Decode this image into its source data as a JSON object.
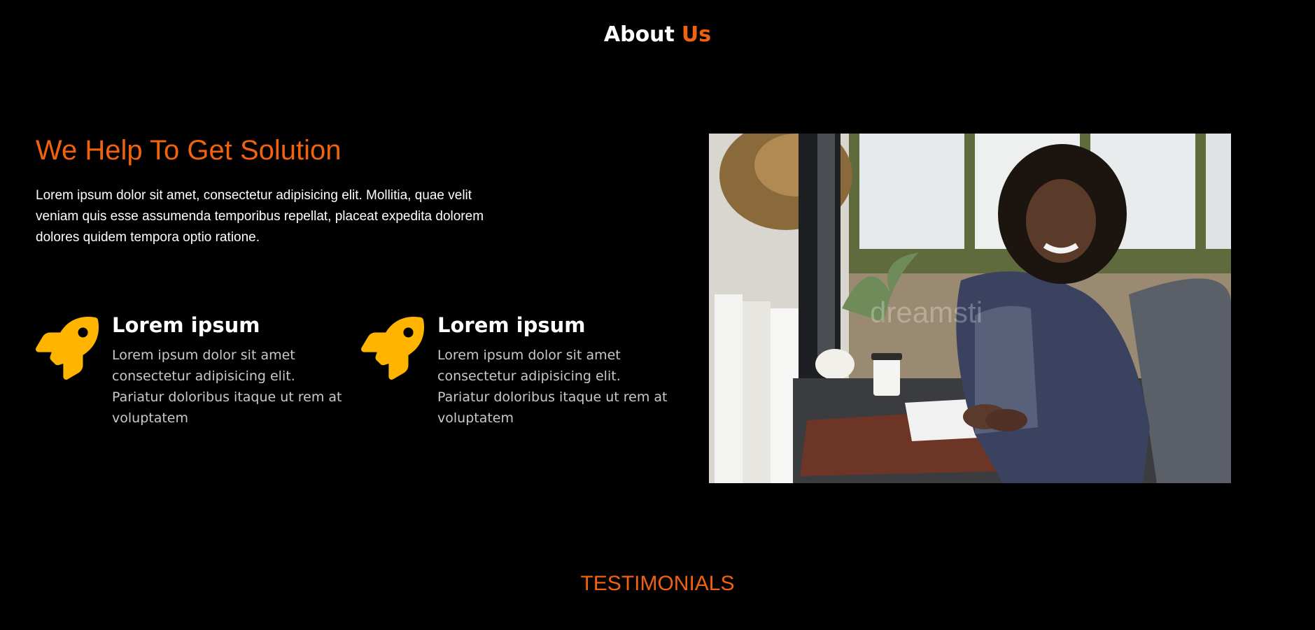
{
  "about": {
    "heading_word1": "About",
    "heading_word2": "Us"
  },
  "hero": {
    "title": "We Help To Get Solution",
    "description": "Lorem ipsum dolor sit amet, consectetur adipisicing elit. Mollitia, quae velit veniam quis esse assumenda temporibus repellat, placeat expedita dolorem dolores quidem tempora optio ratione."
  },
  "features": [
    {
      "icon": "rocket-icon",
      "title": "Lorem ipsum",
      "description": "Lorem ipsum dolor sit amet consectetur adipisicing elit. Pariatur doloribus itaque ut rem at voluptatem"
    },
    {
      "icon": "rocket-icon",
      "title": "Lorem ipsum",
      "description": "Lorem ipsum dolor sit amet consectetur adipisicing elit. Pariatur doloribus itaque ut rem at voluptatem"
    }
  ],
  "photo": {
    "watermark": "dreamsti"
  },
  "testimonials": {
    "heading": "TESTIMONIALS"
  },
  "colors": {
    "accent": "#f0620e",
    "icon": "#ffb400",
    "background": "#000000"
  }
}
